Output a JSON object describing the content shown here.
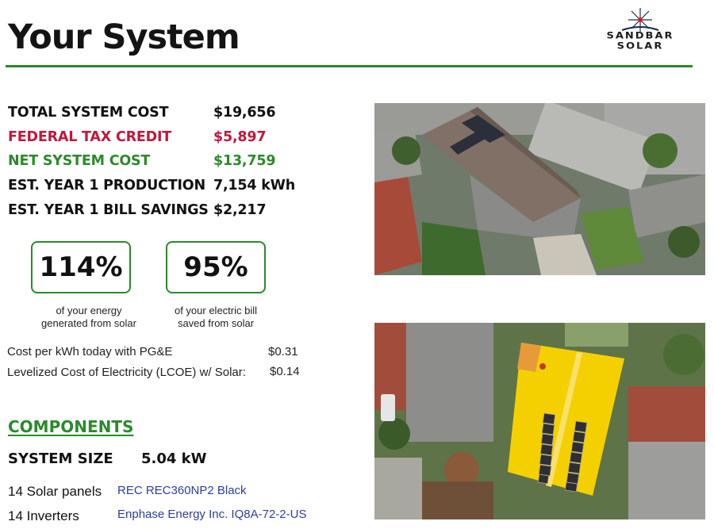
{
  "header": {
    "title": "Your System"
  },
  "logo": {
    "line1": "SANDBAR",
    "line2": "SOLAR"
  },
  "costs": [
    {
      "label": "TOTAL SYSTEM COST",
      "value": "$19,656",
      "tone": "normal"
    },
    {
      "label": "FEDERAL TAX CREDIT",
      "value": "$5,897",
      "tone": "red"
    },
    {
      "label": "NET SYSTEM COST",
      "value": "$13,759",
      "tone": "green"
    },
    {
      "label": "EST. YEAR 1 PRODUCTION",
      "value": "7,154 kWh",
      "tone": "normal"
    },
    {
      "label": "EST. YEAR 1 BILL SAVINGS",
      "value": "$2,217",
      "tone": "normal"
    }
  ],
  "stats": [
    {
      "value": "114%",
      "caption_line1": "of your energy",
      "caption_line2": "generated from solar"
    },
    {
      "value": "95%",
      "caption_line1": "of your electric bill",
      "caption_line2": "saved from solar"
    }
  ],
  "rates": [
    {
      "label": "Cost per kWh today with PG&E",
      "value": "$0.31"
    },
    {
      "label": "Levelized Cost of Electricity (LCOE) w/ Solar:",
      "value": "$0.14"
    }
  ],
  "components": {
    "heading": "COMPONENTS",
    "system_size_label": "SYSTEM SIZE",
    "system_size_value": "5.04 kW",
    "items": [
      {
        "label": "14 Solar panels",
        "model": "REC REC360NP2 Black"
      },
      {
        "label": "14 Inverters",
        "model": "Enphase Energy Inc. IQ8A-72-2-US"
      }
    ]
  },
  "colors": {
    "accent": "#2b8a2b",
    "credit": "#c0183b",
    "link": "#2b3ea0",
    "panel_fill": "#f5d000"
  }
}
